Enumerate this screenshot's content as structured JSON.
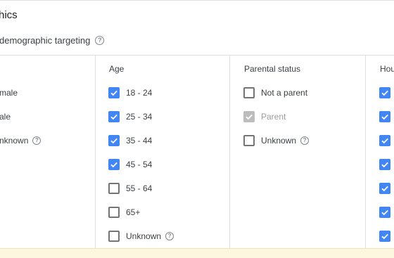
{
  "header": {
    "title": "hics",
    "subtitle": "demographic targeting"
  },
  "gender": {
    "options": [
      {
        "label": "male"
      },
      {
        "label": "ale"
      },
      {
        "label": "nknown"
      }
    ]
  },
  "age": {
    "header": "Age",
    "options": [
      {
        "label": "18 - 24",
        "checked": true
      },
      {
        "label": "25 - 34",
        "checked": true
      },
      {
        "label": "35 - 44",
        "checked": true
      },
      {
        "label": "45 - 54",
        "checked": true
      },
      {
        "label": "55 - 64",
        "checked": false
      },
      {
        "label": "65+",
        "checked": false
      },
      {
        "label": "Unknown",
        "checked": false
      }
    ]
  },
  "parental": {
    "header": "Parental status",
    "options": [
      {
        "label": "Not a parent",
        "state": "unchecked"
      },
      {
        "label": "Parent",
        "state": "disabled-checked"
      },
      {
        "label": "Unknown",
        "state": "unchecked"
      }
    ]
  },
  "household": {
    "header": "Hou",
    "checked_count_visible": 7
  },
  "icons": {
    "help": "help-circle-icon",
    "check": "checkmark-icon"
  },
  "colors": {
    "checkbox_checked": "#4285f4",
    "checkbox_disabled": "#bdbdbd",
    "footer_bar": "#fef7e0"
  }
}
